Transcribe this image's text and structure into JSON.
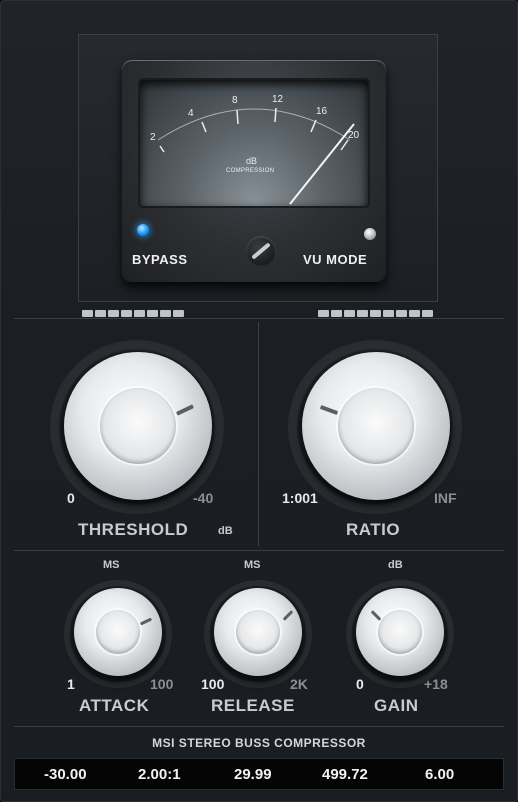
{
  "meter": {
    "scale_labels": [
      "2",
      "4",
      "8",
      "12",
      "16",
      "20"
    ],
    "unit": "dB",
    "caption": "COMPRESSION"
  },
  "bypass": {
    "label": "BYPASS",
    "state": "on",
    "led_color": "#2aa4ff"
  },
  "vu_mode": {
    "label": "VU MODE",
    "state": "off"
  },
  "threshold": {
    "title": "THRESHOLD",
    "unit": "dB",
    "min": "0",
    "max": "-40"
  },
  "ratio": {
    "title": "RATIO",
    "min": "1:001",
    "max": "INF"
  },
  "attack": {
    "title": "ATTACK",
    "unit": "MS",
    "min": "1",
    "max": "100"
  },
  "release": {
    "title": "RELEASE",
    "unit": "MS",
    "min": "100",
    "max": "2K"
  },
  "gain": {
    "title": "GAIN",
    "unit": "dB",
    "min": "0",
    "max": "+18"
  },
  "plugin_name": "MSI STEREO BUSS COMPRESSOR",
  "readouts": [
    "-30.00",
    "2.00:1",
    "29.99",
    "499.72",
    "6.00"
  ]
}
